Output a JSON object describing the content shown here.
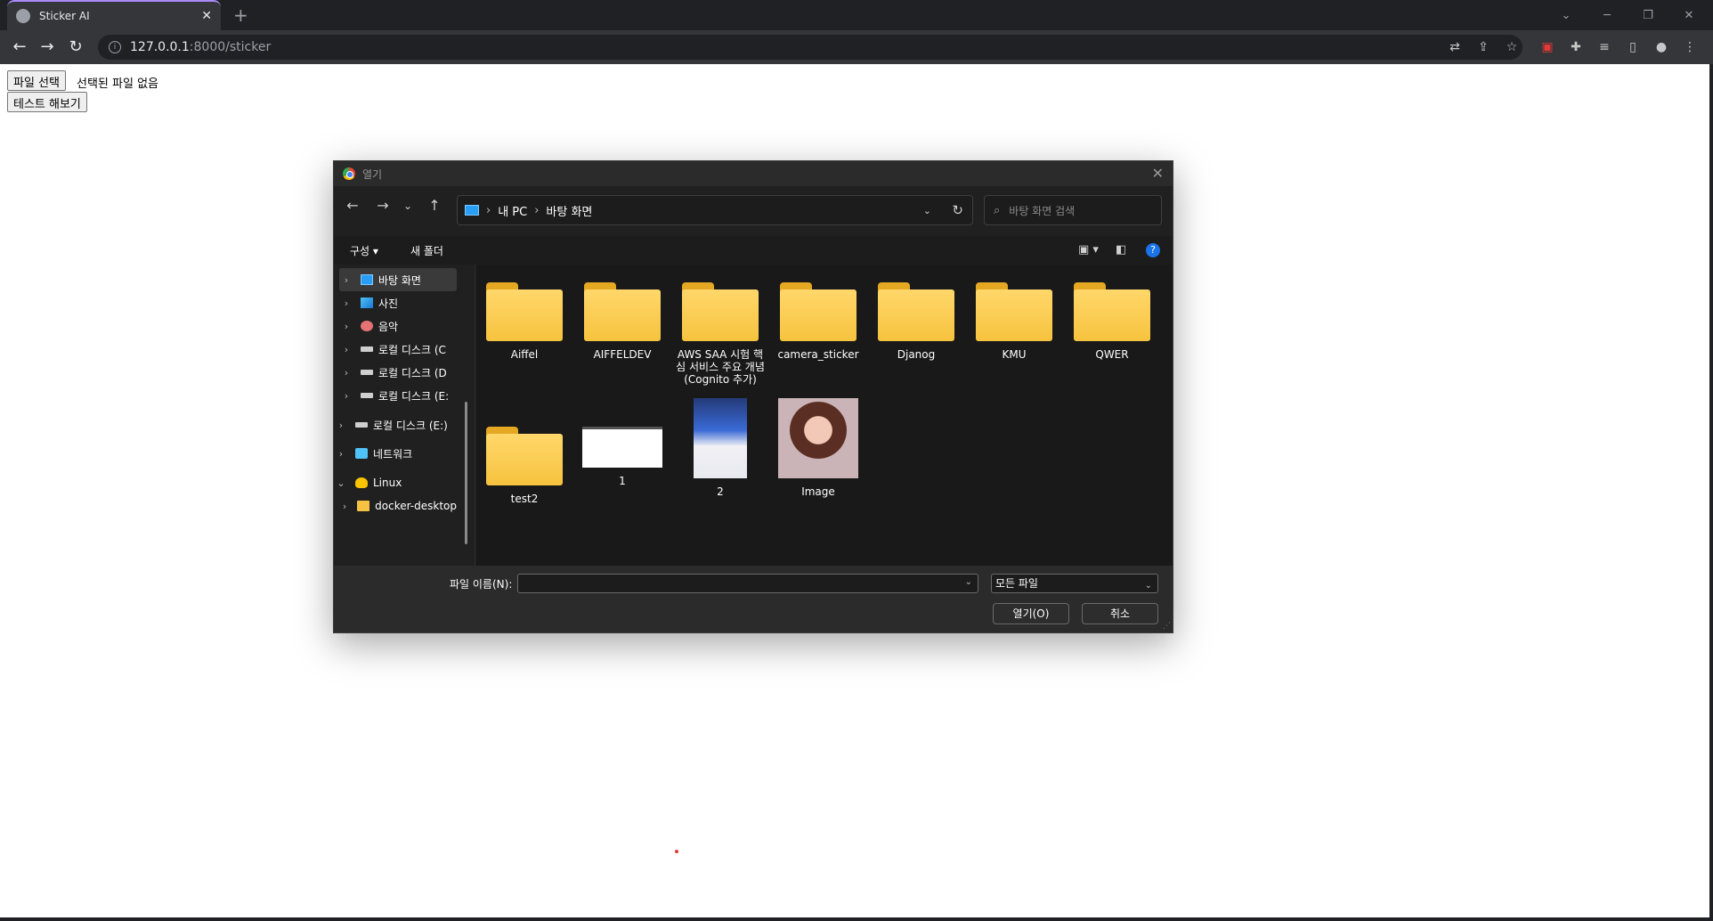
{
  "browser": {
    "tab_title": "Sticker AI",
    "tab_close": "✕",
    "new_tab": "+",
    "url_host": "127.0.0.1",
    "url_path": ":8000/sticker",
    "window_controls": [
      "⌄",
      "─",
      "❐",
      "✕"
    ]
  },
  "page": {
    "file_button": "파일 선택",
    "no_file_text": "선택된 파일 없음",
    "test_button": "테스트 해보기"
  },
  "dialog": {
    "title": "열기",
    "breadcrumb": [
      "내 PC",
      "바탕 화면"
    ],
    "search_placeholder": "바탕 화면 검색",
    "organize": "구성 ▾",
    "new_folder": "새 폴더",
    "sidebar": [
      {
        "label": "바탕 화면",
        "icon": "desktop-icon",
        "selected": true
      },
      {
        "label": "사진",
        "icon": "photo-icon"
      },
      {
        "label": "음악",
        "icon": "music-icon"
      },
      {
        "label": "로컬 디스크 (C",
        "icon": "drive-icon"
      },
      {
        "label": "로컬 디스크 (D",
        "icon": "drive-icon"
      },
      {
        "label": "로컬 디스크 (E:",
        "icon": "drive-icon"
      },
      {
        "label": "로컬 디스크 (E:)",
        "icon": "drive-icon"
      },
      {
        "label": "네트워크",
        "icon": "network-icon"
      },
      {
        "label": "Linux",
        "icon": "linux-icon"
      },
      {
        "label": "docker-desktop",
        "icon": "folder-icon"
      }
    ],
    "files": [
      {
        "name": "Aiffel",
        "type": "folder"
      },
      {
        "name": "AIFFELDEV",
        "type": "folder"
      },
      {
        "name": "AWS SAA 시험 핵심 서비스 주요 개념(Cognito 추가)",
        "type": "folder"
      },
      {
        "name": "camera_sticker",
        "type": "folder"
      },
      {
        "name": "Djanog",
        "type": "folder"
      },
      {
        "name": "KMU",
        "type": "folder"
      },
      {
        "name": "QWER",
        "type": "folder"
      },
      {
        "name": "test2",
        "type": "folder"
      },
      {
        "name": "1",
        "type": "image-white"
      },
      {
        "name": "2",
        "type": "image-photo1"
      },
      {
        "name": "Image",
        "type": "image-photo2"
      }
    ],
    "file_name_label": "파일 이름(N):",
    "file_name_value": "",
    "file_type": "모든 파일",
    "open_button": "열기(O)",
    "cancel_button": "취소"
  }
}
